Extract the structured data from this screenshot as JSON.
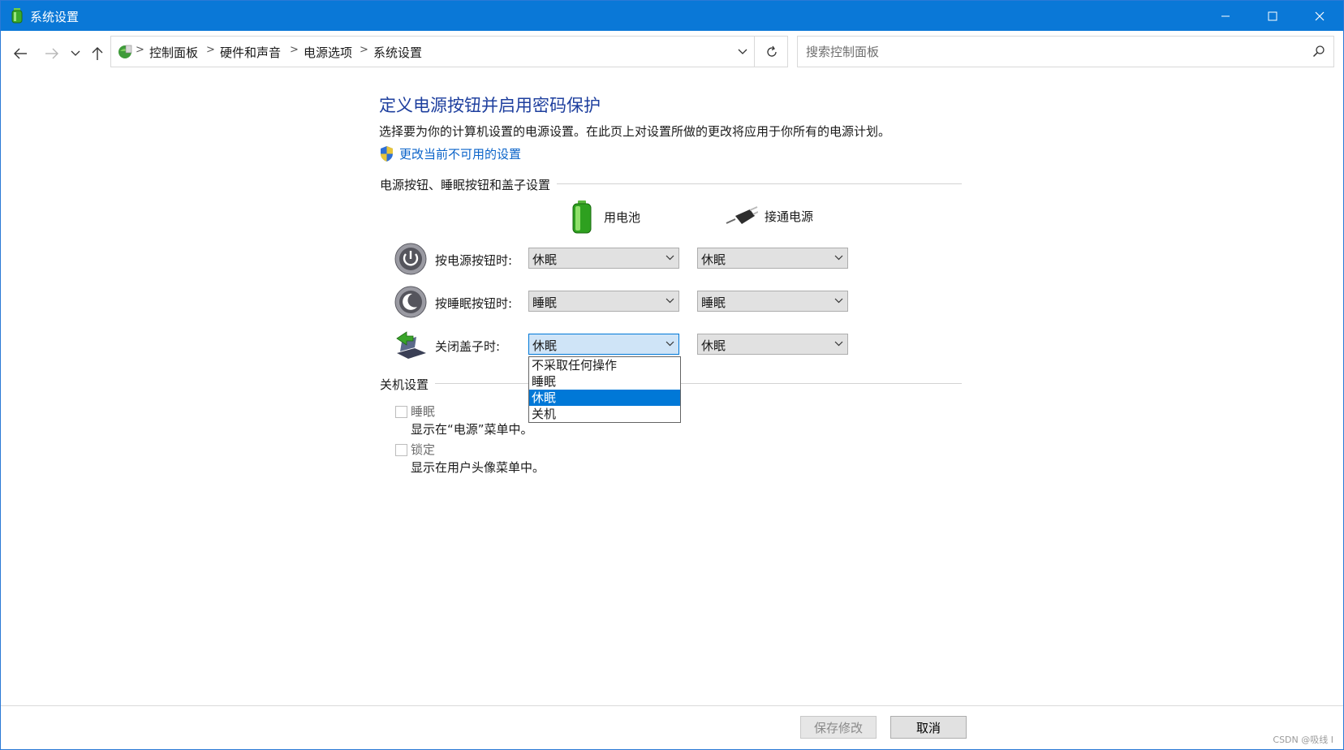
{
  "window": {
    "title": "系统设置",
    "minimize_icon": "minimize-icon",
    "maximize_icon": "maximize-icon",
    "close_icon": "close-icon",
    "titlebar_color": "#0a78d7"
  },
  "nav": {
    "back_icon": "arrow-left-icon",
    "forward_icon": "arrow-right-icon",
    "recent_icon": "chevron-down-icon",
    "up_icon": "arrow-up-icon"
  },
  "address": {
    "crumbs": [
      "控制面板",
      "硬件和声音",
      "电源选项",
      "系统设置"
    ]
  },
  "search": {
    "placeholder": "搜索控制面板"
  },
  "page": {
    "title": "定义电源按钮并启用密码保护",
    "description": "选择要为你的计算机设置的电源设置。在此页上对设置所做的更改将应用于你所有的电源计划。",
    "admin_link": "更改当前不可用的设置",
    "title_color": "#1e3f9e",
    "link_color": "#0a63c9"
  },
  "buttons_section": {
    "label": "电源按钮、睡眠按钮和盖子设置",
    "col_battery": "用电池",
    "col_plugged": "接通电源",
    "rows": [
      {
        "label": "按电源按钮时:",
        "battery": "休眠",
        "plugged": "休眠"
      },
      {
        "label": "按睡眠按钮时:",
        "battery": "睡眠",
        "plugged": "睡眠"
      },
      {
        "label": "关闭盖子时:",
        "battery": "休眠",
        "plugged": "休眠"
      }
    ],
    "open_dropdown": {
      "options": [
        "不采取任何操作",
        "睡眠",
        "休眠",
        "关机"
      ],
      "selected": "休眠"
    }
  },
  "shutdown_section": {
    "label": "关机设置",
    "items": [
      {
        "label": "睡眠",
        "description": "显示在“电源”菜单中。",
        "checked": false
      },
      {
        "label": "锁定",
        "description": "显示在用户头像菜单中。",
        "checked": false
      }
    ]
  },
  "footer": {
    "save": "保存修改",
    "cancel": "取消",
    "watermark": "CSDN @吸线 I"
  }
}
